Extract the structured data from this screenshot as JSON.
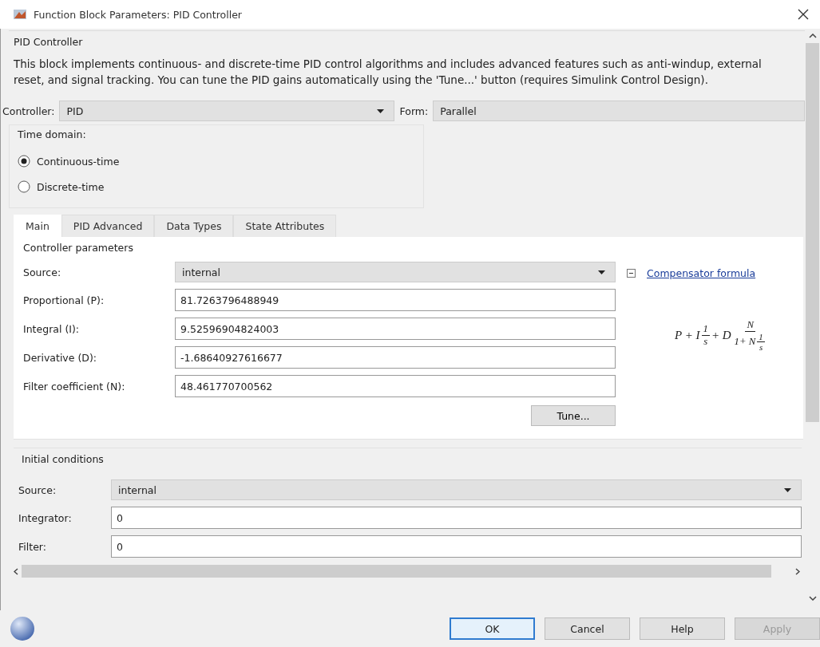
{
  "window": {
    "title": "Function Block Parameters: PID Controller"
  },
  "block": {
    "title": "PID Controller",
    "description": "This block implements continuous- and discrete-time PID control algorithms and includes advanced features such as anti-windup, external reset, and signal tracking. You can tune the PID gains automatically using the 'Tune...' button (requires Simulink Control Design)."
  },
  "controller": {
    "label": "Controller:",
    "value": "PID"
  },
  "form": {
    "label": "Form:",
    "value": "Parallel"
  },
  "time_domain": {
    "title": "Time domain:",
    "options": [
      {
        "label": "Continuous-time",
        "selected": true
      },
      {
        "label": "Discrete-time",
        "selected": false
      }
    ]
  },
  "tabs": [
    {
      "label": "Main",
      "selected": true
    },
    {
      "label": "PID Advanced",
      "selected": false
    },
    {
      "label": "Data Types",
      "selected": false
    },
    {
      "label": "State Attributes",
      "selected": false
    }
  ],
  "controller_parameters": {
    "title": "Controller parameters",
    "fields": [
      {
        "kind": "dropdown",
        "label": "Source:",
        "value": "internal"
      },
      {
        "kind": "text",
        "label": "Proportional (P):",
        "value": "81.7263796488949"
      },
      {
        "kind": "text",
        "label": "Integral (I):",
        "value": "9.52596904824003"
      },
      {
        "kind": "text",
        "label": "Derivative (D):",
        "value": "-1.68640927616677"
      },
      {
        "kind": "text",
        "label": "Filter coefficient (N):",
        "value": "48.461770700562"
      }
    ],
    "tune_button": "Tune...",
    "formula_link": "Compensator formula",
    "formula_expanded": true,
    "formula": [
      {
        "kind": "sym",
        "text": "P + I"
      },
      {
        "kind": "frac",
        "num": [
          {
            "kind": "sym",
            "text": "1"
          }
        ],
        "den": [
          {
            "kind": "sym",
            "text": "s"
          }
        ]
      },
      {
        "kind": "sym",
        "text": "+ D"
      },
      {
        "kind": "frac",
        "num": [
          {
            "kind": "sym",
            "text": "N"
          }
        ],
        "den": [
          {
            "kind": "sym",
            "text": "1+ N"
          },
          {
            "kind": "frac",
            "num": [
              {
                "kind": "sym",
                "text": "1"
              }
            ],
            "den": [
              {
                "kind": "sym",
                "text": "s"
              }
            ]
          }
        ]
      }
    ]
  },
  "initial_conditions": {
    "title": "Initial conditions",
    "fields": [
      {
        "kind": "dropdown",
        "label": "Source:",
        "value": "internal"
      },
      {
        "kind": "text",
        "label": "Integrator:",
        "value": "0"
      },
      {
        "kind": "text",
        "label": "Filter:",
        "value": "0"
      }
    ]
  },
  "buttons": [
    {
      "label": "OK",
      "focused": true,
      "disabled": false
    },
    {
      "label": "Cancel",
      "focused": false,
      "disabled": false
    },
    {
      "label": "Help",
      "focused": false,
      "disabled": false
    },
    {
      "label": "Apply",
      "focused": false,
      "disabled": true
    }
  ]
}
